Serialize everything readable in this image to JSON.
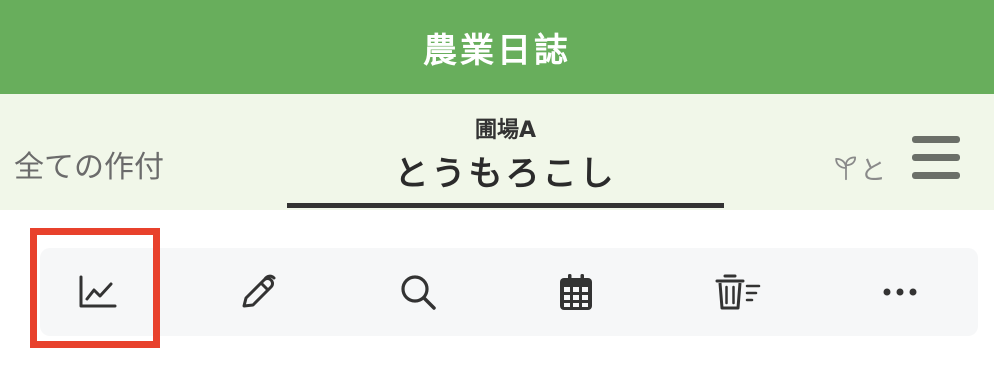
{
  "header": {
    "title": "農業日誌"
  },
  "tabs": {
    "previous": {
      "label": "全ての作付"
    },
    "active": {
      "field": "圃場A",
      "crop": "とうもろこし"
    },
    "next": {
      "icon": "sprout-icon"
    }
  },
  "menu": {
    "icon": "hamburger-menu-icon"
  },
  "toolbar": {
    "items": [
      {
        "icon": "line-chart-icon",
        "selected": true
      },
      {
        "icon": "pen-icon"
      },
      {
        "icon": "search-icon"
      },
      {
        "icon": "calendar-icon"
      },
      {
        "icon": "trash-list-icon"
      },
      {
        "icon": "more-horizontal-icon"
      }
    ]
  },
  "colors": {
    "header_bg": "#68ae5c",
    "tab_bg": "#f1f7e9",
    "highlight": "#e8412c",
    "icon": "#333333"
  }
}
